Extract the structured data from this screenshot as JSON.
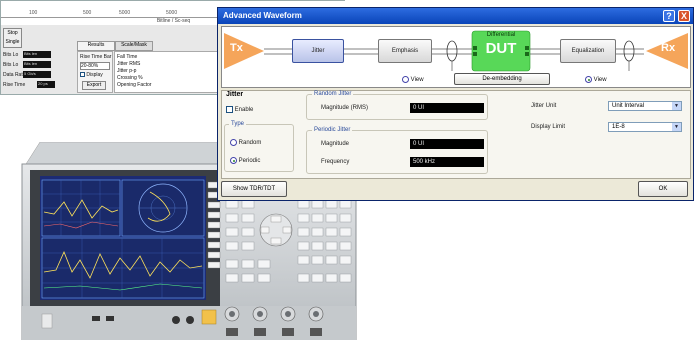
{
  "background_window": {
    "ruler_ticks": [
      "100",
      "500",
      "5000",
      "5000"
    ],
    "ruler_title": "Bitline / Sc-seq",
    "left_labels": [
      "Bits Lo",
      "Bits Lo",
      "Data Rate",
      "Rise Time"
    ],
    "left_values": [
      "Bits len",
      "Bits len",
      "5 Gb/s",
      "20 ps"
    ],
    "stop_button": "Stop",
    "single_button": "Single",
    "tab_results": "Results",
    "tab_scale": "Scale/Mask",
    "results_head": "Rise Time Bar",
    "results_values": [
      "20-80%",
      "20-80%"
    ],
    "display_label": "Display",
    "export_button": "Export",
    "list_items": [
      "Fall Time",
      "Jitter RMS",
      "Jitter p-p",
      "Crossing %",
      "Opening Factor"
    ]
  },
  "dialog": {
    "title": "Advanced Waveform",
    "help_button": "?",
    "close_button": "X",
    "flow": {
      "tx": "Tx",
      "rx": "Rx",
      "jitter": "Jitter",
      "emphasis": "Emphasis",
      "dut_top": "Differential",
      "dut": "DUT",
      "equalization": "Equalization",
      "view1": "View",
      "view2": "View",
      "deembed": "De-embedding"
    },
    "jitter_section": "Jitter",
    "enable_label": "Enable",
    "type_group": "Type",
    "type_random": "Random",
    "type_periodic": "Periodic",
    "random_group": "Random Jitter",
    "rj_mag_label": "Magnitude (RMS)",
    "rj_mag_value": "0 UI",
    "periodic_group": "Periodic Jitter",
    "pj_mag_label": "Magnitude",
    "pj_mag_value": "0 UI",
    "pj_freq_label": "Frequency",
    "pj_freq_value": "500 kHz",
    "jitter_unit_label": "Jitter Unit",
    "jitter_unit_value": "Unit Interval",
    "display_limit_label": "Display Limit",
    "display_limit_value": "1E-8",
    "show_tdr_button": "Show TDR/TDT",
    "ok_button": "OK"
  },
  "colors": {
    "titlebar": "#0a44b8",
    "tx_rx": "#f5a55a",
    "dut": "#58d858",
    "panel": "#ece9d8"
  }
}
